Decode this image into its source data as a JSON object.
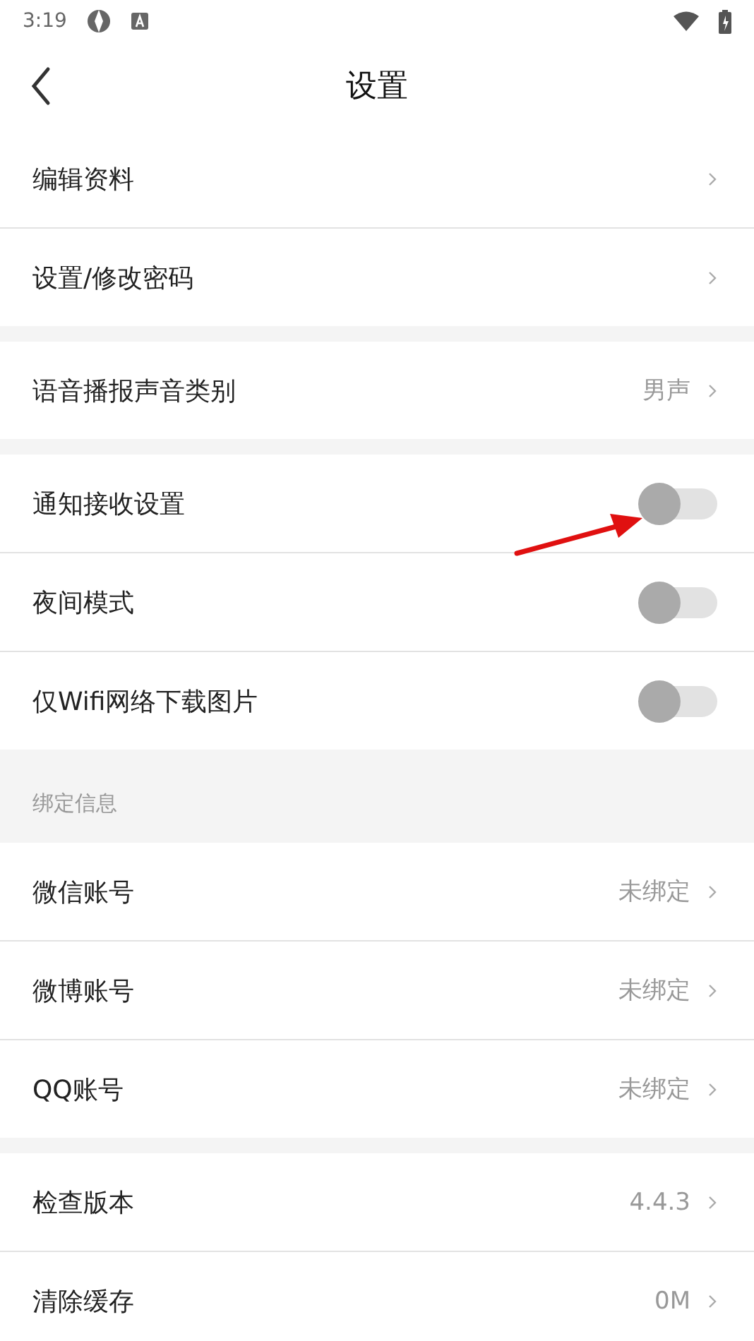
{
  "status_bar": {
    "time": "3:19"
  },
  "header": {
    "title": "设置"
  },
  "groups": [
    {
      "items": [
        {
          "kind": "link",
          "label": "编辑资料"
        },
        {
          "kind": "link",
          "label": "设置/修改密码"
        }
      ]
    },
    {
      "items": [
        {
          "kind": "link",
          "label": "语音播报声音类别",
          "value": "男声"
        }
      ]
    },
    {
      "items": [
        {
          "kind": "toggle",
          "label": "通知接收设置",
          "on": false
        },
        {
          "kind": "toggle",
          "label": "夜间模式",
          "on": false
        },
        {
          "kind": "toggle",
          "label": "仅Wifi网络下载图片",
          "on": false
        }
      ]
    },
    {
      "title": "绑定信息",
      "items": [
        {
          "kind": "link",
          "label": "微信账号",
          "value": "未绑定"
        },
        {
          "kind": "link",
          "label": "微博账号",
          "value": "未绑定"
        },
        {
          "kind": "link",
          "label": "QQ账号",
          "value": "未绑定"
        }
      ]
    },
    {
      "items": [
        {
          "kind": "link",
          "label": "检查版本",
          "value": "4.4.3"
        },
        {
          "kind": "link",
          "label": "清除缓存",
          "value": "0M"
        }
      ]
    }
  ]
}
